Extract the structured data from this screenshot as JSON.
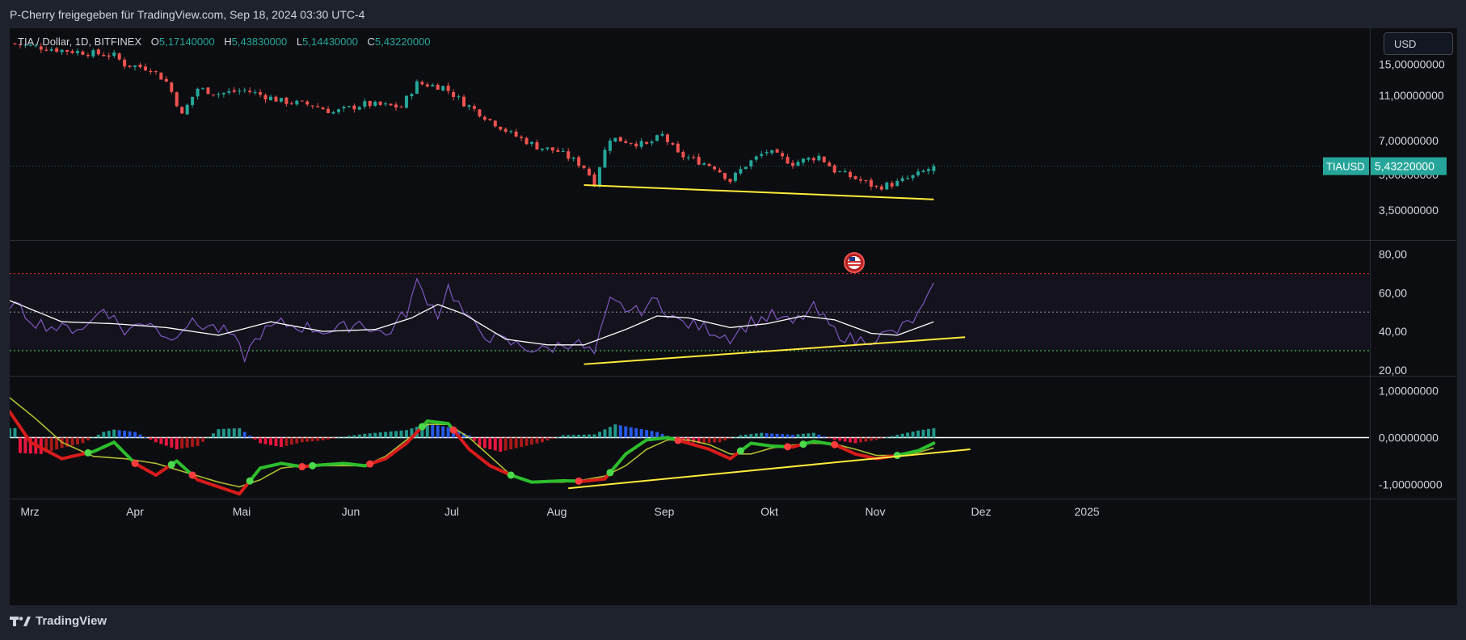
{
  "header": {
    "title": "P-Cherry freigegeben für TradingView.com, Sep 18, 2024 03:30 UTC-4"
  },
  "legend": {
    "symbol": "TIA / Dollar, 1D, BITFINEX",
    "o_label": "O",
    "o_value": "5,17140000",
    "h_label": "H",
    "h_value": "5,43830000",
    "l_label": "L",
    "l_value": "5,14430000",
    "c_label": "C",
    "c_value": "5,43220000"
  },
  "currency_button": "USD",
  "price_tag": {
    "symbol": "TIAUSD",
    "value": "5,43220000"
  },
  "footer": {
    "brand": "TradingView"
  },
  "colors": {
    "up": "#26a69a",
    "down": "#ef5350",
    "rsi": "#7e57c2",
    "trendline": "#ffeb3b",
    "macd_up": "#2dbd2d",
    "macd_down": "#d81b1b"
  },
  "chart_data": [
    {
      "type": "candlestick",
      "title": "TIA / Dollar, 1D, BITFINEX",
      "yscale": "log",
      "ylim": [
        2.6,
        20.5
      ],
      "y_ticks": [
        {
          "value": 15,
          "label": "15,00000000"
        },
        {
          "value": 11,
          "label": "11,00000000"
        },
        {
          "value": 7,
          "label": "7,00000000"
        },
        {
          "value": 5,
          "label": "5,00000000"
        },
        {
          "value": 3.5,
          "label": "3,50000000"
        }
      ],
      "x_ticks": [
        "Mrz",
        "Apr",
        "Mai",
        "Jun",
        "Jul",
        "Aug",
        "Sep",
        "Okt",
        "Nov",
        "Dez",
        "2025"
      ],
      "close_path": [
        [
          0,
          18.5
        ],
        [
          10,
          17.3
        ],
        [
          20,
          16.4
        ],
        [
          22,
          15.0
        ],
        [
          27,
          14.4
        ],
        [
          30,
          12.6
        ],
        [
          33,
          9.0
        ],
        [
          36,
          11.8
        ],
        [
          40,
          11.2
        ],
        [
          45,
          11.6
        ],
        [
          52,
          10.4
        ],
        [
          58,
          10.0
        ],
        [
          62,
          9.3
        ],
        [
          68,
          10.1
        ],
        [
          75,
          9.8
        ],
        [
          78,
          12.4
        ],
        [
          83,
          12.0
        ],
        [
          87,
          10.2
        ],
        [
          92,
          8.6
        ],
        [
          96,
          7.5
        ],
        [
          101,
          6.6
        ],
        [
          105,
          6.3
        ],
        [
          110,
          5.4
        ],
        [
          112,
          4.6
        ],
        [
          115,
          7.2
        ],
        [
          122,
          6.7
        ],
        [
          125,
          7.4
        ],
        [
          128,
          6.1
        ],
        [
          135,
          5.4
        ],
        [
          138,
          4.7
        ],
        [
          141,
          5.5
        ],
        [
          145,
          6.3
        ],
        [
          150,
          5.6
        ],
        [
          155,
          6.0
        ],
        [
          158,
          5.2
        ],
        [
          162,
          4.8
        ],
        [
          166,
          4.4
        ],
        [
          170,
          4.6
        ],
        [
          174,
          5.0
        ],
        [
          177,
          5.43
        ]
      ],
      "last_price": 5.4322,
      "annotations": [
        {
          "type": "trendline",
          "from": [
            110,
            4.5
          ],
          "to": [
            177,
            3.9
          ]
        }
      ]
    },
    {
      "type": "line",
      "name": "RSI",
      "ylim": [
        17,
        87
      ],
      "y_ticks": [
        {
          "value": 80,
          "label": "80,00"
        },
        {
          "value": 60,
          "label": "60,00"
        },
        {
          "value": 40,
          "label": "40,00"
        },
        {
          "value": 20,
          "label": "20,00"
        }
      ],
      "levels": [
        70,
        50,
        30
      ],
      "rsi_path": [
        [
          0,
          55
        ],
        [
          5,
          45
        ],
        [
          10,
          41
        ],
        [
          15,
          43
        ],
        [
          18,
          53
        ],
        [
          22,
          40
        ],
        [
          27,
          46
        ],
        [
          30,
          36
        ],
        [
          34,
          44
        ],
        [
          38,
          43
        ],
        [
          42,
          39
        ],
        [
          45,
          27
        ],
        [
          48,
          39
        ],
        [
          52,
          44
        ],
        [
          57,
          42
        ],
        [
          62,
          40
        ],
        [
          67,
          45
        ],
        [
          72,
          38
        ],
        [
          76,
          50
        ],
        [
          78,
          65
        ],
        [
          82,
          49
        ],
        [
          84,
          63
        ],
        [
          88,
          45
        ],
        [
          92,
          37
        ],
        [
          97,
          33
        ],
        [
          102,
          30
        ],
        [
          108,
          35
        ],
        [
          112,
          28
        ],
        [
          115,
          55
        ],
        [
          120,
          50
        ],
        [
          124,
          56
        ],
        [
          128,
          45
        ],
        [
          133,
          42
        ],
        [
          138,
          37
        ],
        [
          142,
          45
        ],
        [
          146,
          48
        ],
        [
          150,
          44
        ],
        [
          154,
          52
        ],
        [
          158,
          40
        ],
        [
          162,
          35
        ],
        [
          166,
          37
        ],
        [
          170,
          40
        ],
        [
          174,
          48
        ],
        [
          177,
          62
        ]
      ],
      "ma_path": [
        [
          0,
          56
        ],
        [
          10,
          45
        ],
        [
          20,
          44
        ],
        [
          30,
          42
        ],
        [
          40,
          38
        ],
        [
          50,
          45
        ],
        [
          60,
          40
        ],
        [
          70,
          41
        ],
        [
          77,
          47
        ],
        [
          82,
          54
        ],
        [
          87,
          49
        ],
        [
          95,
          36
        ],
        [
          103,
          33
        ],
        [
          110,
          33
        ],
        [
          118,
          41
        ],
        [
          124,
          48
        ],
        [
          130,
          47
        ],
        [
          138,
          42
        ],
        [
          145,
          44
        ],
        [
          152,
          48
        ],
        [
          158,
          46
        ],
        [
          165,
          39
        ],
        [
          170,
          38
        ],
        [
          177,
          45
        ]
      ],
      "annotations": [
        {
          "type": "trendline",
          "from": [
            110,
            23
          ],
          "to": [
            183,
            37
          ]
        }
      ]
    },
    {
      "type": "bar",
      "name": "MACD",
      "ylim": [
        -1.3,
        1.3
      ],
      "y_ticks": [
        {
          "value": 1,
          "label": "1,00000000"
        },
        {
          "value": 0,
          "label": "0,00000000"
        },
        {
          "value": -1,
          "label": "-1,00000000"
        }
      ],
      "histogram": [
        [
          2,
          -0.33
        ],
        [
          6,
          -0.35
        ],
        [
          10,
          -0.22
        ],
        [
          14,
          -0.12
        ],
        [
          18,
          0.12
        ],
        [
          20,
          0.17
        ],
        [
          24,
          0.12
        ],
        [
          28,
          -0.1
        ],
        [
          32,
          -0.25
        ],
        [
          36,
          -0.18
        ],
        [
          40,
          0.18
        ],
        [
          44,
          0.2
        ],
        [
          48,
          -0.12
        ],
        [
          52,
          -0.2
        ],
        [
          56,
          -0.1
        ],
        [
          60,
          -0.06
        ],
        [
          64,
          0.02
        ],
        [
          68,
          0.08
        ],
        [
          72,
          0.12
        ],
        [
          76,
          0.16
        ],
        [
          80,
          0.3
        ],
        [
          84,
          0.22
        ],
        [
          88,
          0.05
        ],
        [
          90,
          -0.2
        ],
        [
          94,
          -0.3
        ],
        [
          98,
          -0.2
        ],
        [
          102,
          -0.1
        ],
        [
          106,
          0.05
        ],
        [
          112,
          0.07
        ],
        [
          116,
          0.28
        ],
        [
          120,
          0.2
        ],
        [
          124,
          0.12
        ],
        [
          128,
          -0.05
        ],
        [
          132,
          -0.12
        ],
        [
          136,
          -0.1
        ],
        [
          140,
          0.05
        ],
        [
          144,
          0.1
        ],
        [
          150,
          0.06
        ],
        [
          154,
          0.1
        ],
        [
          158,
          -0.05
        ],
        [
          162,
          -0.12
        ],
        [
          166,
          -0.05
        ],
        [
          170,
          0.06
        ],
        [
          174,
          0.15
        ],
        [
          177,
          0.2
        ]
      ],
      "macd_path": [
        [
          0,
          0.55
        ],
        [
          4,
          -0.1
        ],
        [
          10,
          -0.45
        ],
        [
          16,
          -0.3
        ],
        [
          20,
          -0.1
        ],
        [
          24,
          -0.55
        ],
        [
          28,
          -0.8
        ],
        [
          32,
          -0.5
        ],
        [
          36,
          -0.9
        ],
        [
          40,
          -1.05
        ],
        [
          44,
          -1.2
        ],
        [
          48,
          -0.65
        ],
        [
          52,
          -0.55
        ],
        [
          56,
          -0.62
        ],
        [
          60,
          -0.58
        ],
        [
          64,
          -0.55
        ],
        [
          68,
          -0.6
        ],
        [
          72,
          -0.45
        ],
        [
          76,
          -0.12
        ],
        [
          80,
          0.35
        ],
        [
          84,
          0.3
        ],
        [
          88,
          -0.25
        ],
        [
          92,
          -0.6
        ],
        [
          96,
          -0.8
        ],
        [
          100,
          -0.95
        ],
        [
          106,
          -0.92
        ],
        [
          110,
          -0.93
        ],
        [
          114,
          -0.88
        ],
        [
          118,
          -0.35
        ],
        [
          122,
          -0.05
        ],
        [
          126,
          0.0
        ],
        [
          130,
          -0.12
        ],
        [
          134,
          -0.25
        ],
        [
          138,
          -0.45
        ],
        [
          142,
          -0.12
        ],
        [
          146,
          -0.18
        ],
        [
          150,
          -0.2
        ],
        [
          154,
          -0.08
        ],
        [
          158,
          -0.15
        ],
        [
          162,
          -0.35
        ],
        [
          166,
          -0.45
        ],
        [
          170,
          -0.38
        ],
        [
          174,
          -0.28
        ],
        [
          177,
          -0.12
        ]
      ],
      "signal_path": [
        [
          0,
          0.85
        ],
        [
          5,
          0.4
        ],
        [
          10,
          -0.1
        ],
        [
          16,
          -0.4
        ],
        [
          22,
          -0.45
        ],
        [
          28,
          -0.55
        ],
        [
          34,
          -0.75
        ],
        [
          40,
          -0.95
        ],
        [
          44,
          -1.05
        ],
        [
          48,
          -0.9
        ],
        [
          52,
          -0.65
        ],
        [
          56,
          -0.6
        ],
        [
          62,
          -0.6
        ],
        [
          68,
          -0.6
        ],
        [
          72,
          -0.4
        ],
        [
          76,
          -0.05
        ],
        [
          80,
          0.28
        ],
        [
          84,
          0.28
        ],
        [
          88,
          0.0
        ],
        [
          92,
          -0.4
        ],
        [
          96,
          -0.8
        ],
        [
          100,
          -0.95
        ],
        [
          106,
          -0.95
        ],
        [
          110,
          -0.9
        ],
        [
          114,
          -0.82
        ],
        [
          118,
          -0.6
        ],
        [
          122,
          -0.25
        ],
        [
          126,
          -0.05
        ],
        [
          130,
          -0.05
        ],
        [
          134,
          -0.15
        ],
        [
          138,
          -0.35
        ],
        [
          142,
          -0.35
        ],
        [
          146,
          -0.22
        ],
        [
          150,
          -0.16
        ],
        [
          154,
          -0.12
        ],
        [
          158,
          -0.14
        ],
        [
          162,
          -0.25
        ],
        [
          166,
          -0.38
        ],
        [
          170,
          -0.38
        ],
        [
          174,
          -0.32
        ],
        [
          177,
          -0.22
        ]
      ],
      "annotations": [
        {
          "type": "trendline",
          "from": [
            107,
            -1.08
          ],
          "to": [
            184,
            -0.25
          ]
        }
      ]
    }
  ]
}
